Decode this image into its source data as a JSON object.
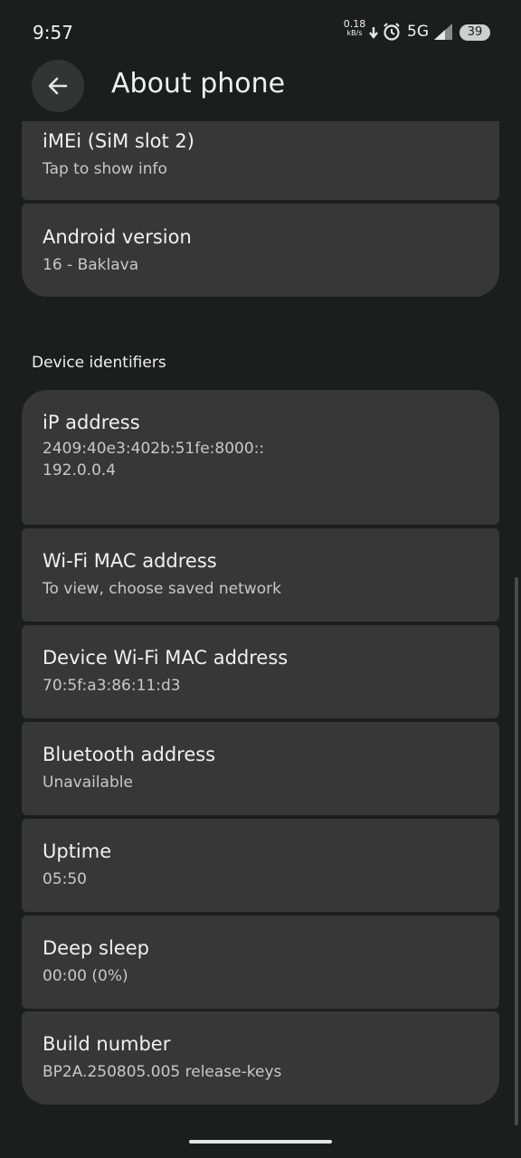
{
  "status": {
    "time": "9:57",
    "speed_value": "0.18",
    "speed_unit": "kB/s",
    "network": "5G",
    "battery": "39"
  },
  "header": {
    "title": "About phone"
  },
  "items_top": [
    {
      "title": "iMEi (SiM slot 2)",
      "subtitle": "Tap to show info"
    },
    {
      "title": "Android version",
      "subtitle": "16 - Baklava"
    }
  ],
  "section": {
    "title": "Device identifiers"
  },
  "items": [
    {
      "title": "iP address",
      "subtitle": "2409:40e3:402b:51fe:8000::\n192.0.0.4"
    },
    {
      "title": "Wi-Fi MAC address",
      "subtitle": "To view, choose saved network"
    },
    {
      "title": "Device Wi-Fi MAC address",
      "subtitle": "70:5f:a3:86:11:d3"
    },
    {
      "title": "Bluetooth address",
      "subtitle": "Unavailable"
    },
    {
      "title": "Uptime",
      "subtitle": "05:50"
    },
    {
      "title": "Deep sleep",
      "subtitle": "00:00 (0%)"
    },
    {
      "title": "Build number",
      "subtitle": "BP2A.250805.005 release-keys"
    }
  ],
  "icons": {
    "back": "arrow-left-icon",
    "download": "download-arrow-icon",
    "alarm": "alarm-clock-icon",
    "signal": "signal-icon",
    "battery": "battery-icon"
  }
}
